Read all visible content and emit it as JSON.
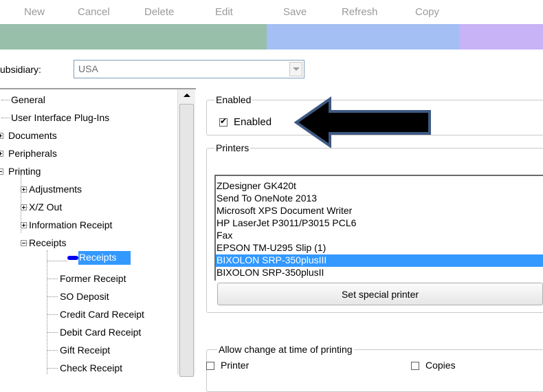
{
  "toolbar": {
    "new": "New",
    "cancel": "Cancel",
    "delete": "Delete",
    "edit": "Edit",
    "save": "Save",
    "refresh": "Refresh",
    "copy": "Copy"
  },
  "band_colors": [
    "#97bfaa",
    "#a4bff3",
    "#c7b3f5"
  ],
  "subsidiary": {
    "label": "ubsidiary:",
    "value": "USA"
  },
  "tree": {
    "items": [
      "General",
      "User Interface Plug-Ins",
      "Documents",
      "Peripherals",
      "Printing",
      "Adjustments",
      "X/Z Out",
      "Information Receipt",
      "Receipts",
      "Receipts",
      "Former Receipt",
      "SO Deposit",
      "Credit Card Receipt",
      "Debit Card Receipt",
      "Gift Receipt",
      "Check Receipt"
    ],
    "selected": "Receipts"
  },
  "enabled_group": {
    "legend": "Enabled",
    "checkbox_label": "Enabled",
    "checked": true
  },
  "printers_group": {
    "legend": "Printers",
    "items": [
      "ZDesigner GK420t",
      "Send To OneNote 2013",
      "Microsoft XPS Document Writer",
      "HP LaserJet P3011/P3015 PCL6",
      "Fax",
      "EPSON TM-U295 Slip (1)",
      "BIXOLON SRP-350plusIII",
      "BIXOLON SRP-350plusII"
    ],
    "selected": "BIXOLON SRP-350plusIII",
    "button": "Set special printer"
  },
  "allow_group": {
    "legend": "Allow change at time of printing",
    "printer": "Printer",
    "copies": "Copies"
  },
  "arrow_color": "#000000",
  "arrow_outline": "#3f5a82"
}
